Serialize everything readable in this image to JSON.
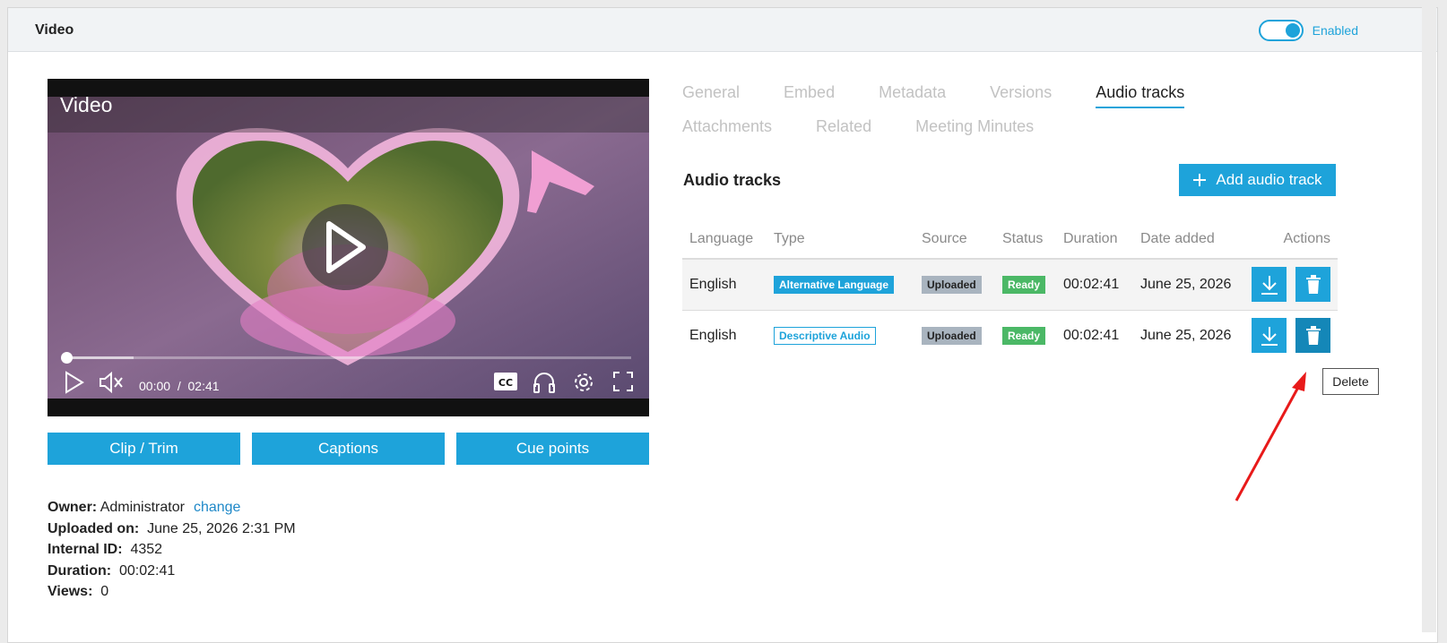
{
  "panel": {
    "title": "Video",
    "toggle_label": "Enabled",
    "toggle_on": true,
    "accent_color": "#1ea3da"
  },
  "player": {
    "title": "Video",
    "current_time": "00:00",
    "separator": "/",
    "total_time": "02:41",
    "progress": 0.0,
    "icons": [
      "play-icon",
      "volume-icon",
      "captions-icon",
      "audio-tracks-icon",
      "settings-icon",
      "fullscreen-icon"
    ]
  },
  "buttons": {
    "clip_trim": "Clip / Trim",
    "captions": "Captions",
    "cue_points": "Cue points"
  },
  "meta": {
    "owner_label": "Owner:",
    "owner_value": "Administrator",
    "change_link": "change",
    "uploaded_label": "Uploaded on:",
    "uploaded_value": "June 25, 2026 2:31 PM",
    "internal_id_label": "Internal ID:",
    "internal_id_value": "4352",
    "duration_label": "Duration:",
    "duration_value": "00:02:41",
    "views_label": "Views:",
    "views_value": "0"
  },
  "tabs": {
    "row1": [
      "General",
      "Embed",
      "Metadata",
      "Versions",
      "Audio tracks"
    ],
    "row2": [
      "Attachments",
      "Related",
      "Meeting Minutes"
    ],
    "active": "Audio tracks"
  },
  "audio_tracks": {
    "title": "Audio tracks",
    "add_button": "Add audio track",
    "columns": [
      "Language",
      "Type",
      "Source",
      "Status",
      "Duration",
      "Date added",
      "Actions"
    ],
    "rows": [
      {
        "language": "English",
        "type": "Alternative Language",
        "source": "Uploaded",
        "status": "Ready",
        "duration": "00:02:41",
        "date_added": "June 25, 2026"
      },
      {
        "language": "English",
        "type": "Descriptive Audio",
        "source": "Uploaded",
        "status": "Ready",
        "duration": "00:02:41",
        "date_added": "June 25, 2026"
      }
    ]
  },
  "tooltip": {
    "text": "Delete"
  }
}
